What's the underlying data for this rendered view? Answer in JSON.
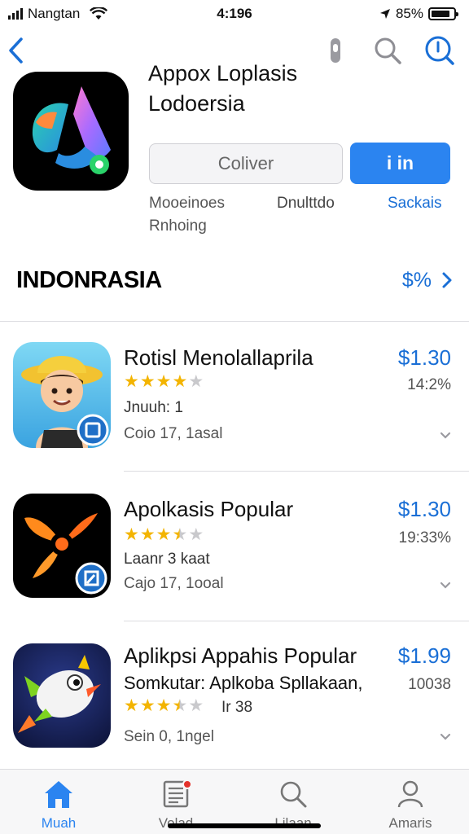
{
  "status_bar": {
    "carrier": "Nangtan",
    "time": "4:196",
    "battery": "85%",
    "battery_level": 0.85
  },
  "nav": {
    "back_icon": "chevron-left-icon",
    "actions": [
      "mic-icon",
      "search-icon",
      "info-icon"
    ]
  },
  "header": {
    "app_title_line1": "Appox Loplasis",
    "app_title_line2": "Lodoersia",
    "get_button": "Coliver",
    "open_button": "i in",
    "meta_left_line1": "Mooeinoes",
    "meta_left_line2": "Rnhoing",
    "meta_middle": "Dnulttdo",
    "meta_right": "Sackais"
  },
  "region": {
    "name": "INDONRASIA",
    "link": "$%"
  },
  "list": [
    {
      "title": "Rotisl Menolallaprila",
      "price": "$1.30",
      "percent": "14:2%",
      "rating": 4,
      "line1": "Jnuuh: 1",
      "line2": "Coio 17, 1asal",
      "icon": "cowboy-kid-icon"
    },
    {
      "title": "Apolkasis Popular",
      "price": "$1.30",
      "percent": "19:33%",
      "rating": 3.5,
      "line1": "Laanr 3 kaat",
      "line2": "Cajo 17, 1ooal",
      "icon": "orange-propeller-icon"
    },
    {
      "title": "Aplikpsi Appahis Popular",
      "price": "$1.99",
      "percent": "10038",
      "subtitle": "Somkutar: Aplkoba Spllakaan,",
      "rating": 3.5,
      "rating_text": "Ir 38",
      "line2": "Sein 0, 1ngel",
      "icon": "bird-rocket-icon"
    }
  ],
  "tabs": [
    {
      "label": "Muah",
      "icon": "home-icon",
      "active": true
    },
    {
      "label": "Volad",
      "icon": "news-icon",
      "active": false,
      "badge": true
    },
    {
      "label": "Lilaan",
      "icon": "search-icon",
      "active": false
    },
    {
      "label": "Amaris",
      "icon": "person-icon",
      "active": false
    }
  ],
  "colors": {
    "accent": "#2b84f0",
    "link": "#1a6fd6",
    "star": "#f3b400",
    "badge": "#e4322b"
  }
}
